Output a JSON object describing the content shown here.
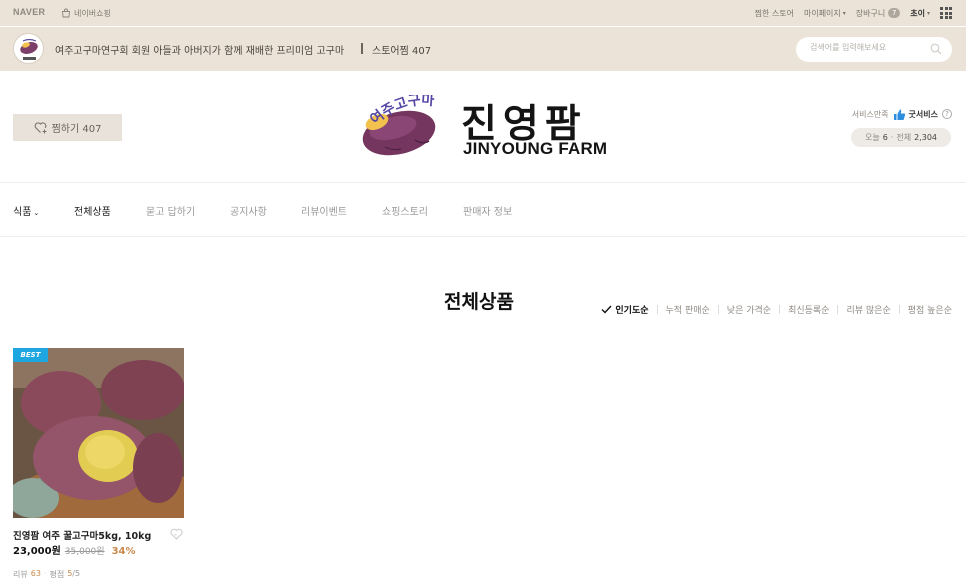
{
  "topbar": {
    "naver_logo": "NAVER",
    "shopping_link": "네이버쇼핑",
    "links": {
      "favorite_store": "찜한 스토어",
      "mypage": "마이페이지",
      "cart": "장바구니",
      "cart_count": "7",
      "user": "초이"
    }
  },
  "store": {
    "description": "여주고구마연구회 회원 아들과 아버지가 함께 재배한 프리미엄 고구마",
    "favorites": "스토어찜 407",
    "search": {
      "placeholder": "검색어를 입력해보세요"
    }
  },
  "header": {
    "zzim_label": "찜하기 407",
    "brand_title": "진영팜",
    "brand_subtitle": "JINYOUNG FARM",
    "logo_arc_text": "여주고구마",
    "service_label": "서비스만족",
    "service_value": "굿서비스",
    "visits": {
      "today_label": "오늘",
      "today": "6",
      "total_label": "전체",
      "total": "2,304"
    }
  },
  "nav": {
    "items": [
      "식품",
      "전체상품",
      "묻고 답하기",
      "공지사항",
      "리뷰이벤트",
      "쇼핑스토리",
      "판매자 정보"
    ]
  },
  "section": {
    "title": "전체상품",
    "sort_options": [
      "인기도순",
      "누적 판매순",
      "낮은 가격순",
      "최신등록순",
      "리뷰 많은순",
      "평점 높은순"
    ],
    "active_sort": "인기도순"
  },
  "products": [
    {
      "badge": "BEST",
      "name": "진영팜 여주 꿀고구마5kg, 10kg",
      "price": "23,000원",
      "original_price": "35,000원",
      "discount": "34%",
      "review_label": "리뷰",
      "review_count": "63",
      "rating_label": "평점",
      "rating": "5",
      "rating_max": "/5"
    }
  ],
  "colors": {
    "topbar_bg": "#ebe3d8",
    "accent_badge": "#1ea6e0",
    "discount": "#c8894b"
  }
}
